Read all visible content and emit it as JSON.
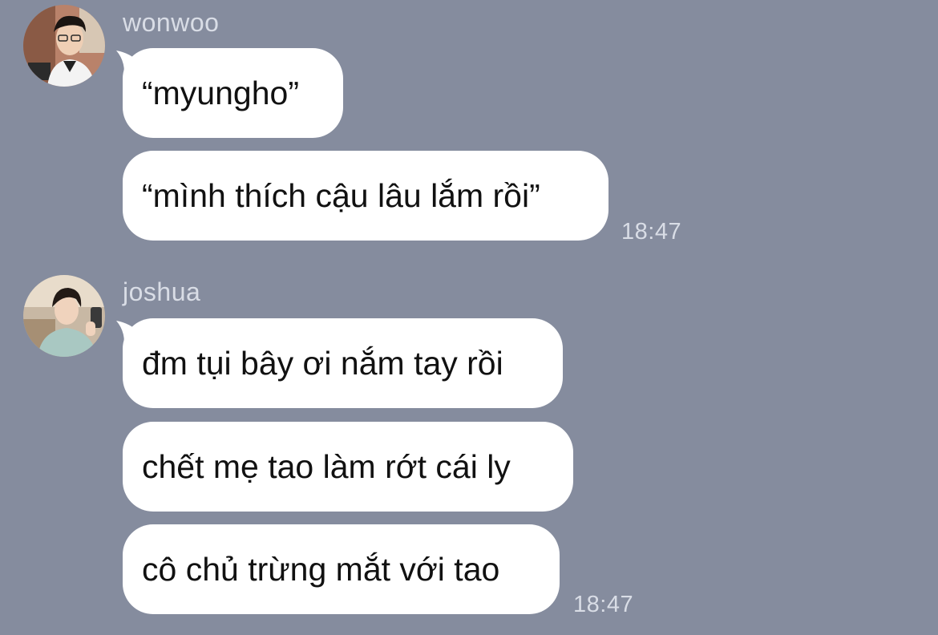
{
  "messages": [
    {
      "sender": "wonwoo",
      "avatar_icon": "person-avatar-icon",
      "bubbles": [
        "“myungho”",
        "“mình thích cậu lâu lắm rồi”"
      ],
      "time": "18:47"
    },
    {
      "sender": "joshua",
      "avatar_icon": "person-avatar-icon",
      "bubbles": [
        "đm tụi bây ơi nắm tay rồi",
        "chết mẹ tao làm rớt cái ly",
        "cô chủ trừng mắt với tao"
      ],
      "time": "18:47"
    }
  ],
  "colors": {
    "background": "#858c9e",
    "bubble": "#ffffff",
    "meta_text": "#d9dde6",
    "message_text": "#111111"
  }
}
